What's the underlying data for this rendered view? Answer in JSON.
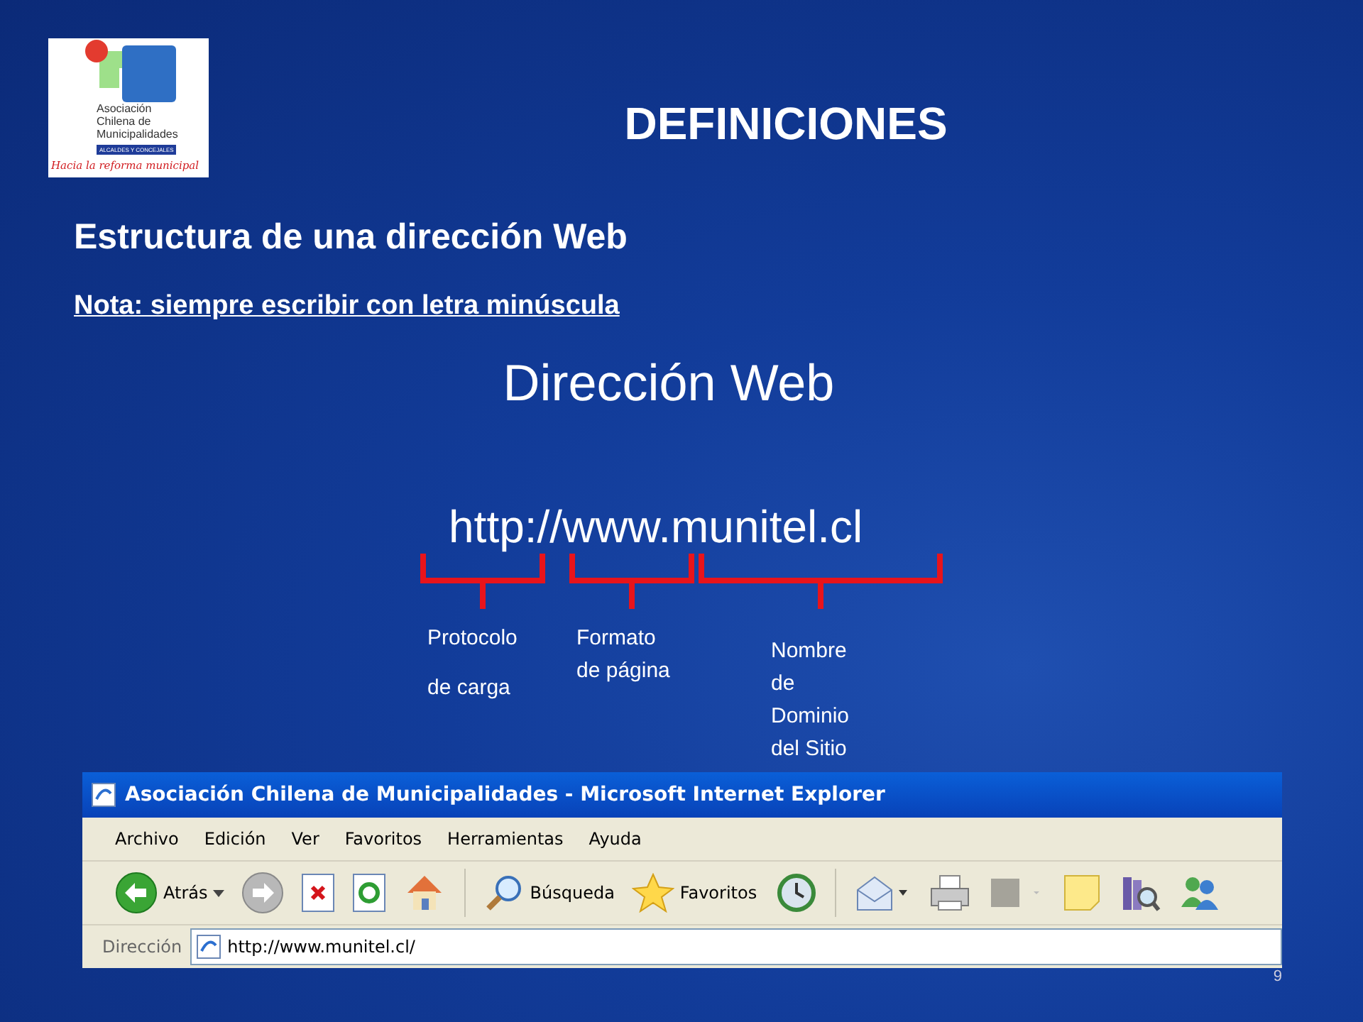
{
  "logo": {
    "lines": [
      "Asociación",
      "Chilena de",
      "Municipalidades"
    ],
    "band": "ALCALDES Y CONCEJALES",
    "slogan": "Hacia la reforma municipal"
  },
  "title": "DEFINICIONES",
  "subtitle": "Estructura de una dirección Web",
  "note": "Nota: siempre escribir con letra minúscula",
  "heading": "Dirección Web",
  "url": "http://www.munitel.cl",
  "url_parts": [
    {
      "lines": [
        "Protocolo",
        "de carga"
      ]
    },
    {
      "lines": [
        "Formato",
        "de página"
      ]
    },
    {
      "lines": [
        "Nombre",
        "de",
        "Dominio",
        "del Sitio"
      ]
    }
  ],
  "browser": {
    "window_title": "Asociación Chilena de Municipalidades - Microsoft Internet Explorer",
    "menu": [
      "Archivo",
      "Edición",
      "Ver",
      "Favoritos",
      "Herramientas",
      "Ayuda"
    ],
    "toolbar": [
      {
        "kind": "back",
        "label": "Atrás"
      },
      {
        "kind": "forward"
      },
      {
        "kind": "stop"
      },
      {
        "kind": "refresh"
      },
      {
        "kind": "home"
      },
      {
        "kind": "separator"
      },
      {
        "kind": "search",
        "label": "Búsqueda"
      },
      {
        "kind": "favorites",
        "label": "Favoritos"
      },
      {
        "kind": "history"
      },
      {
        "kind": "separator"
      },
      {
        "kind": "mail"
      },
      {
        "kind": "print"
      },
      {
        "kind": "blank"
      },
      {
        "kind": "note"
      },
      {
        "kind": "research"
      },
      {
        "kind": "messenger"
      }
    ],
    "address": {
      "label": "Dirección",
      "value": "http://www.munitel.cl/"
    }
  },
  "page_number": "9"
}
